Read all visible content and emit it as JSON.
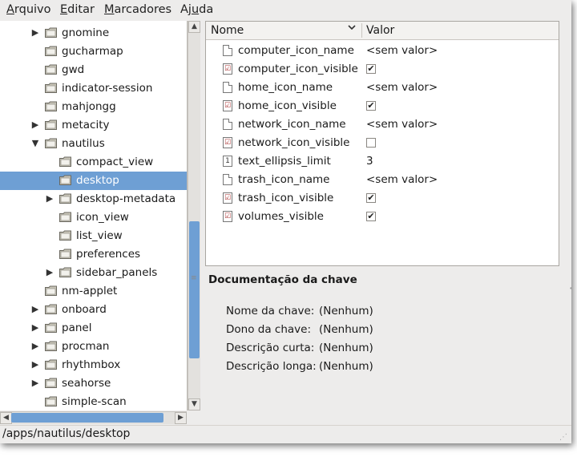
{
  "menubar": [
    {
      "pre": "",
      "u": "A",
      "post": "rquivo"
    },
    {
      "pre": "",
      "u": "E",
      "post": "ditar"
    },
    {
      "pre": "",
      "u": "M",
      "post": "arcadores"
    },
    {
      "pre": "Aj",
      "u": "u",
      "post": "da"
    }
  ],
  "tree": [
    {
      "label": "gnomine",
      "expander": "▶",
      "indent": 0
    },
    {
      "label": "gucharmap",
      "expander": "",
      "indent": 0
    },
    {
      "label": "gwd",
      "expander": "",
      "indent": 0
    },
    {
      "label": "indicator-session",
      "expander": "",
      "indent": 0
    },
    {
      "label": "mahjongg",
      "expander": "",
      "indent": 0
    },
    {
      "label": "metacity",
      "expander": "▶",
      "indent": 0
    },
    {
      "label": "nautilus",
      "expander": "▼",
      "indent": 0
    },
    {
      "label": "compact_view",
      "expander": "",
      "indent": 1
    },
    {
      "label": "desktop",
      "expander": "",
      "indent": 1,
      "selected": true
    },
    {
      "label": "desktop-metadata",
      "expander": "▶",
      "indent": 1
    },
    {
      "label": "icon_view",
      "expander": "",
      "indent": 1
    },
    {
      "label": "list_view",
      "expander": "",
      "indent": 1
    },
    {
      "label": "preferences",
      "expander": "",
      "indent": 1
    },
    {
      "label": "sidebar_panels",
      "expander": "▶",
      "indent": 1
    },
    {
      "label": "nm-applet",
      "expander": "",
      "indent": 0
    },
    {
      "label": "onboard",
      "expander": "▶",
      "indent": 0
    },
    {
      "label": "panel",
      "expander": "▶",
      "indent": 0
    },
    {
      "label": "procman",
      "expander": "▶",
      "indent": 0
    },
    {
      "label": "rhythmbox",
      "expander": "▶",
      "indent": 0
    },
    {
      "label": "seahorse",
      "expander": "▶",
      "indent": 0
    },
    {
      "label": "simple-scan",
      "expander": "",
      "indent": 0
    }
  ],
  "list": {
    "col_name": "Nome",
    "col_value": "Valor",
    "sort_icon": "chevron-down-icon",
    "rows": [
      {
        "name": "computer_icon_name",
        "type": "string",
        "value": "<sem valor>"
      },
      {
        "name": "computer_icon_visible",
        "type": "bool",
        "checked": true
      },
      {
        "name": "home_icon_name",
        "type": "string",
        "value": "<sem valor>"
      },
      {
        "name": "home_icon_visible",
        "type": "bool",
        "checked": true
      },
      {
        "name": "network_icon_name",
        "type": "string",
        "value": "<sem valor>"
      },
      {
        "name": "network_icon_visible",
        "type": "bool",
        "checked": false
      },
      {
        "name": "text_ellipsis_limit",
        "type": "int",
        "value": "3"
      },
      {
        "name": "trash_icon_name",
        "type": "string",
        "value": "<sem valor>"
      },
      {
        "name": "trash_icon_visible",
        "type": "bool",
        "checked": true
      },
      {
        "name": "volumes_visible",
        "type": "bool",
        "checked": true
      }
    ]
  },
  "doc": {
    "title": "Documentação da chave",
    "fields": [
      {
        "label": "Nome da chave:",
        "value": "(Nenhum)"
      },
      {
        "label": "Dono da chave:",
        "value": "(Nenhum)"
      },
      {
        "label": "Descrição curta:",
        "value": "(Nenhum)"
      },
      {
        "label": "Descrição longa:",
        "value": "(Nenhum)"
      }
    ]
  },
  "status": {
    "path": "/apps/nautilus/desktop"
  },
  "colors": {
    "selection": "#6e9fd4",
    "folder": "#c8c5b8"
  }
}
